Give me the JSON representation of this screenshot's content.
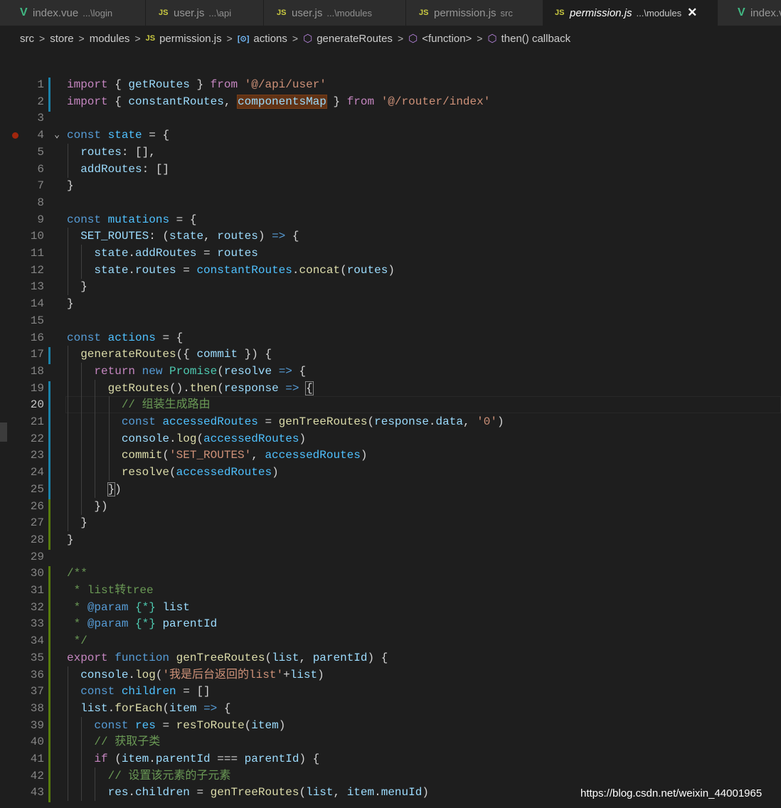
{
  "tabs": [
    {
      "icon": "V",
      "icon_kind": "vue",
      "name": "index.vue",
      "path": "...\\login",
      "active": false,
      "w": 205
    },
    {
      "icon": "JS",
      "icon_kind": "js",
      "name": "user.js",
      "path": "...\\api",
      "active": false,
      "w": 166
    },
    {
      "icon": "JS",
      "icon_kind": "js",
      "name": "user.js",
      "path": "...\\modules",
      "active": false,
      "w": 200
    },
    {
      "icon": "JS",
      "icon_kind": "js",
      "name": "permission.js",
      "path": "src",
      "active": false,
      "w": 193
    },
    {
      "icon": "JS",
      "icon_kind": "js",
      "name": "permission.js",
      "path": "...\\modules",
      "active": true,
      "w": 245
    },
    {
      "icon": "V",
      "icon_kind": "vue",
      "name": "index.v",
      "path": "",
      "active": false,
      "w": 120
    }
  ],
  "breadcrumb": [
    {
      "label": "src",
      "icon": ""
    },
    {
      "label": "store",
      "icon": ""
    },
    {
      "label": "modules",
      "icon": ""
    },
    {
      "label": "permission.js",
      "icon": "JS",
      "icon_kind": "js"
    },
    {
      "label": "actions",
      "icon": "[⊙]",
      "icon_kind": "field"
    },
    {
      "label": "generateRoutes",
      "icon": "⬡",
      "icon_kind": "method"
    },
    {
      "label": "<function>",
      "icon": "⬡",
      "icon_kind": "method"
    },
    {
      "label": "then() callback",
      "icon": "⬡",
      "icon_kind": "method"
    }
  ],
  "close_glyph": "✕",
  "code": [
    {
      "n": 1,
      "t": [
        [
          "k",
          "import"
        ],
        [
          "p",
          " { "
        ],
        [
          "v",
          "getRoutes"
        ],
        [
          "p",
          " } "
        ],
        [
          "k",
          "from"
        ],
        [
          "p",
          " "
        ],
        [
          "s",
          "'@/api/user'"
        ]
      ]
    },
    {
      "n": 2,
      "t": [
        [
          "k",
          "import"
        ],
        [
          "p",
          " { "
        ],
        [
          "v",
          "constantRoutes"
        ],
        [
          "p",
          ", "
        ],
        [
          "v hl",
          "componentsMap"
        ],
        [
          "p",
          " } "
        ],
        [
          "k",
          "from"
        ],
        [
          "p",
          " "
        ],
        [
          "s",
          "'@/router/index'"
        ]
      ]
    },
    {
      "n": 3,
      "t": []
    },
    {
      "n": 4,
      "t": [
        [
          "st",
          "const"
        ],
        [
          "p",
          " "
        ],
        [
          "c",
          "state"
        ],
        [
          "p",
          " = {"
        ]
      ]
    },
    {
      "n": 5,
      "t": [
        [
          "p",
          "  "
        ],
        [
          "v",
          "routes"
        ],
        [
          "p",
          ": [],"
        ]
      ]
    },
    {
      "n": 6,
      "t": [
        [
          "p",
          "  "
        ],
        [
          "v",
          "addRoutes"
        ],
        [
          "p",
          ": []"
        ]
      ]
    },
    {
      "n": 7,
      "t": [
        [
          "p",
          "}"
        ]
      ]
    },
    {
      "n": 8,
      "t": []
    },
    {
      "n": 9,
      "t": [
        [
          "st",
          "const"
        ],
        [
          "p",
          " "
        ],
        [
          "c",
          "mutations"
        ],
        [
          "p",
          " = {"
        ]
      ]
    },
    {
      "n": 10,
      "t": [
        [
          "p",
          "  "
        ],
        [
          "v",
          "SET_ROUTES"
        ],
        [
          "p",
          ": ("
        ],
        [
          "v",
          "state"
        ],
        [
          "p",
          ", "
        ],
        [
          "v",
          "routes"
        ],
        [
          "p",
          ") "
        ],
        [
          "st",
          "=>"
        ],
        [
          "p",
          " {"
        ]
      ]
    },
    {
      "n": 11,
      "t": [
        [
          "p",
          "    "
        ],
        [
          "v",
          "state"
        ],
        [
          "p",
          "."
        ],
        [
          "v",
          "addRoutes"
        ],
        [
          "p",
          " = "
        ],
        [
          "v",
          "routes"
        ]
      ]
    },
    {
      "n": 12,
      "t": [
        [
          "p",
          "    "
        ],
        [
          "v",
          "state"
        ],
        [
          "p",
          "."
        ],
        [
          "v",
          "routes"
        ],
        [
          "p",
          " = "
        ],
        [
          "c",
          "constantRoutes"
        ],
        [
          "p",
          "."
        ],
        [
          "f",
          "concat"
        ],
        [
          "p",
          "("
        ],
        [
          "v",
          "routes"
        ],
        [
          "p",
          ")"
        ]
      ]
    },
    {
      "n": 13,
      "t": [
        [
          "p",
          "  }"
        ]
      ]
    },
    {
      "n": 14,
      "t": [
        [
          "p",
          "}"
        ]
      ]
    },
    {
      "n": 15,
      "t": []
    },
    {
      "n": 16,
      "t": [
        [
          "st",
          "const"
        ],
        [
          "p",
          " "
        ],
        [
          "c",
          "actions"
        ],
        [
          "p",
          " = {"
        ]
      ]
    },
    {
      "n": 17,
      "t": [
        [
          "p",
          "  "
        ],
        [
          "f",
          "generateRoutes"
        ],
        [
          "p",
          "({ "
        ],
        [
          "v",
          "commit"
        ],
        [
          "p",
          " }) {"
        ]
      ]
    },
    {
      "n": 18,
      "t": [
        [
          "p",
          "    "
        ],
        [
          "k",
          "return"
        ],
        [
          "p",
          " "
        ],
        [
          "st",
          "new"
        ],
        [
          "p",
          " "
        ],
        [
          "t",
          "Promise"
        ],
        [
          "p",
          "("
        ],
        [
          "v",
          "resolve"
        ],
        [
          "p",
          " "
        ],
        [
          "st",
          "=>"
        ],
        [
          "p",
          " {"
        ]
      ]
    },
    {
      "n": 19,
      "t": [
        [
          "p",
          "      "
        ],
        [
          "f",
          "getRoutes"
        ],
        [
          "p",
          "()."
        ],
        [
          "f",
          "then"
        ],
        [
          "p",
          "("
        ],
        [
          "v",
          "response"
        ],
        [
          "p",
          " "
        ],
        [
          "st",
          "=>"
        ],
        [
          "p",
          " "
        ],
        [
          "p bm",
          "{"
        ]
      ]
    },
    {
      "n": 20,
      "t": [
        [
          "p",
          "        "
        ],
        [
          "cm",
          "// 组装生成路由"
        ]
      ]
    },
    {
      "n": 21,
      "t": [
        [
          "p",
          "        "
        ],
        [
          "st",
          "const"
        ],
        [
          "p",
          " "
        ],
        [
          "c",
          "accessedRoutes"
        ],
        [
          "p",
          " = "
        ],
        [
          "f",
          "genTreeRoutes"
        ],
        [
          "p",
          "("
        ],
        [
          "v",
          "response"
        ],
        [
          "p",
          "."
        ],
        [
          "v",
          "data"
        ],
        [
          "p",
          ", "
        ],
        [
          "s",
          "'0'"
        ],
        [
          "p",
          ")"
        ]
      ]
    },
    {
      "n": 22,
      "t": [
        [
          "p",
          "        "
        ],
        [
          "v",
          "console"
        ],
        [
          "p",
          "."
        ],
        [
          "f",
          "log"
        ],
        [
          "p",
          "("
        ],
        [
          "c",
          "accessedRoutes"
        ],
        [
          "p",
          ")"
        ]
      ]
    },
    {
      "n": 23,
      "t": [
        [
          "p",
          "        "
        ],
        [
          "f",
          "commit"
        ],
        [
          "p",
          "("
        ],
        [
          "s",
          "'SET_ROUTES'"
        ],
        [
          "p",
          ", "
        ],
        [
          "c",
          "accessedRoutes"
        ],
        [
          "p",
          ")"
        ]
      ]
    },
    {
      "n": 24,
      "t": [
        [
          "p",
          "        "
        ],
        [
          "f",
          "resolve"
        ],
        [
          "p",
          "("
        ],
        [
          "c",
          "accessedRoutes"
        ],
        [
          "p",
          ")"
        ]
      ]
    },
    {
      "n": 25,
      "t": [
        [
          "p",
          "      "
        ],
        [
          "p bm",
          "}"
        ],
        [
          "p",
          ")"
        ]
      ]
    },
    {
      "n": 26,
      "t": [
        [
          "p",
          "    })"
        ]
      ]
    },
    {
      "n": 27,
      "t": [
        [
          "p",
          "  }"
        ]
      ]
    },
    {
      "n": 28,
      "t": [
        [
          "p",
          "}"
        ]
      ]
    },
    {
      "n": 29,
      "t": []
    },
    {
      "n": 30,
      "t": [
        [
          "cm",
          "/**"
        ]
      ]
    },
    {
      "n": 31,
      "t": [
        [
          "cm",
          " * list转tree"
        ]
      ]
    },
    {
      "n": 32,
      "t": [
        [
          "cm",
          " * "
        ],
        [
          "st",
          "@param"
        ],
        [
          "cm",
          " "
        ],
        [
          "t",
          "{*}"
        ],
        [
          "cm",
          " "
        ],
        [
          "v",
          "list"
        ]
      ]
    },
    {
      "n": 33,
      "t": [
        [
          "cm",
          " * "
        ],
        [
          "st",
          "@param"
        ],
        [
          "cm",
          " "
        ],
        [
          "t",
          "{*}"
        ],
        [
          "cm",
          " "
        ],
        [
          "v",
          "parentId"
        ]
      ]
    },
    {
      "n": 34,
      "t": [
        [
          "cm",
          " */"
        ]
      ]
    },
    {
      "n": 35,
      "t": [
        [
          "k",
          "export"
        ],
        [
          "p",
          " "
        ],
        [
          "st",
          "function"
        ],
        [
          "p",
          " "
        ],
        [
          "f",
          "genTreeRoutes"
        ],
        [
          "p",
          "("
        ],
        [
          "v",
          "list"
        ],
        [
          "p",
          ", "
        ],
        [
          "v",
          "parentId"
        ],
        [
          "p",
          ") {"
        ]
      ]
    },
    {
      "n": 36,
      "t": [
        [
          "p",
          "  "
        ],
        [
          "v",
          "console"
        ],
        [
          "p",
          "."
        ],
        [
          "f",
          "log"
        ],
        [
          "p",
          "("
        ],
        [
          "s",
          "'我是后台返回的list'"
        ],
        [
          "p",
          "+"
        ],
        [
          "v",
          "list"
        ],
        [
          "p",
          ")"
        ]
      ]
    },
    {
      "n": 37,
      "t": [
        [
          "p",
          "  "
        ],
        [
          "st",
          "const"
        ],
        [
          "p",
          " "
        ],
        [
          "c",
          "children"
        ],
        [
          "p",
          " = []"
        ]
      ]
    },
    {
      "n": 38,
      "t": [
        [
          "p",
          "  "
        ],
        [
          "v",
          "list"
        ],
        [
          "p",
          "."
        ],
        [
          "f",
          "forEach"
        ],
        [
          "p",
          "("
        ],
        [
          "v",
          "item"
        ],
        [
          "p",
          " "
        ],
        [
          "st",
          "=>"
        ],
        [
          "p",
          " {"
        ]
      ]
    },
    {
      "n": 39,
      "t": [
        [
          "p",
          "    "
        ],
        [
          "st",
          "const"
        ],
        [
          "p",
          " "
        ],
        [
          "c",
          "res"
        ],
        [
          "p",
          " = "
        ],
        [
          "f",
          "resToRoute"
        ],
        [
          "p",
          "("
        ],
        [
          "v",
          "item"
        ],
        [
          "p",
          ")"
        ]
      ]
    },
    {
      "n": 40,
      "t": [
        [
          "p",
          "    "
        ],
        [
          "cm",
          "// 获取子类"
        ]
      ]
    },
    {
      "n": 41,
      "t": [
        [
          "p",
          "    "
        ],
        [
          "k",
          "if"
        ],
        [
          "p",
          " ("
        ],
        [
          "v",
          "item"
        ],
        [
          "p",
          "."
        ],
        [
          "v",
          "parentId"
        ],
        [
          "p",
          " === "
        ],
        [
          "v",
          "parentId"
        ],
        [
          "p",
          ") {"
        ]
      ]
    },
    {
      "n": 42,
      "t": [
        [
          "p",
          "      "
        ],
        [
          "cm",
          "// 设置该元素的子元素"
        ]
      ]
    },
    {
      "n": 43,
      "t": [
        [
          "p",
          "      "
        ],
        [
          "v",
          "res"
        ],
        [
          "p",
          "."
        ],
        [
          "v",
          "children"
        ],
        [
          "p",
          " = "
        ],
        [
          "f",
          "genTreeRoutes"
        ],
        [
          "p",
          "("
        ],
        [
          "v",
          "list"
        ],
        [
          "p",
          ", "
        ],
        [
          "v",
          "item"
        ],
        [
          "p",
          "."
        ],
        [
          "v",
          "menuId"
        ],
        [
          "p",
          ")"
        ]
      ]
    }
  ],
  "gutter_marks": {
    "mod": [
      1,
      2,
      17,
      19,
      20,
      21,
      22,
      23,
      24,
      25
    ],
    "add": [
      26,
      27,
      28,
      30,
      31,
      32,
      33,
      34,
      35,
      36,
      37,
      38,
      39,
      40,
      41,
      42,
      43
    ]
  },
  "fold_lines": [
    4,
    17,
    19
  ],
  "fold_glyph": "⌄",
  "current_line": 20,
  "breakpoint_line": 4,
  "watermark": "https://blog.csdn.net/weixin_44001965"
}
